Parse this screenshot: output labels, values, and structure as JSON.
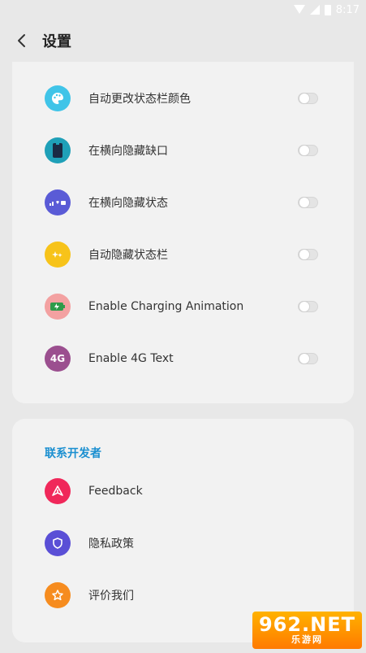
{
  "status_bar": {
    "time": "8:17"
  },
  "header": {
    "title": "设置"
  },
  "settings": [
    {
      "label": "自动更改状态栏颜色",
      "icon": "palette-icon",
      "color": "#40c4e8"
    },
    {
      "label": "在横向隐藏缺口",
      "icon": "notch-phone-icon",
      "color": "#1fa0b8"
    },
    {
      "label": "在横向隐藏状态",
      "icon": "status-icons-icon",
      "color": "#5a5bd6"
    },
    {
      "label": "自动隐藏状态栏",
      "icon": "sparkle-icon",
      "color": "#f7c31a"
    },
    {
      "label": "Enable Charging Animation",
      "icon": "battery-charging-icon",
      "color": "#f3a1a1"
    },
    {
      "label": "Enable 4G Text",
      "icon": "4g-icon",
      "color": "#9b4f8f",
      "icon_text": "4G"
    }
  ],
  "developer": {
    "section_title": "联系开发者",
    "items": [
      {
        "label": "Feedback",
        "icon": "send-icon",
        "color": "#f0285a"
      },
      {
        "label": "隐私政策",
        "icon": "shield-icon",
        "color": "#5a4fd6"
      },
      {
        "label": "评价我们",
        "icon": "star-icon",
        "color": "#f68c1f"
      }
    ]
  },
  "watermark": {
    "big": "962.NET",
    "small": "乐游网"
  }
}
